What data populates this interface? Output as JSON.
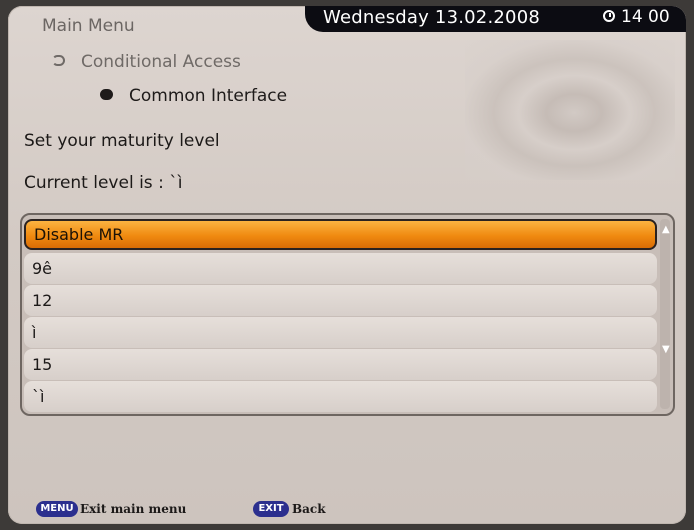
{
  "header": {
    "menu_title": "Main Menu",
    "date": "Wednesday 13.02.2008",
    "time": "14 00"
  },
  "breadcrumb": {
    "level1": "Conditional Access",
    "level2": "Common Interface"
  },
  "content": {
    "prompt": "Set your maturity level",
    "current_level": "Current level is : `ì"
  },
  "list": {
    "items": [
      "Disable MR",
      "9ê",
      "12",
      "ì",
      "15",
      "`ì"
    ],
    "selected_index": 0
  },
  "footer": {
    "menu_key": "MENU",
    "menu_label": "Exit main menu",
    "exit_key": "EXIT",
    "exit_label": "Back"
  },
  "colors": {
    "highlight": "#f08a10",
    "key_button": "#2b2f8e",
    "header_bar": "#0c0c12"
  },
  "icons": [
    "clock-icon",
    "arrow-icon",
    "scroll-up-icon",
    "scroll-down-icon"
  ]
}
